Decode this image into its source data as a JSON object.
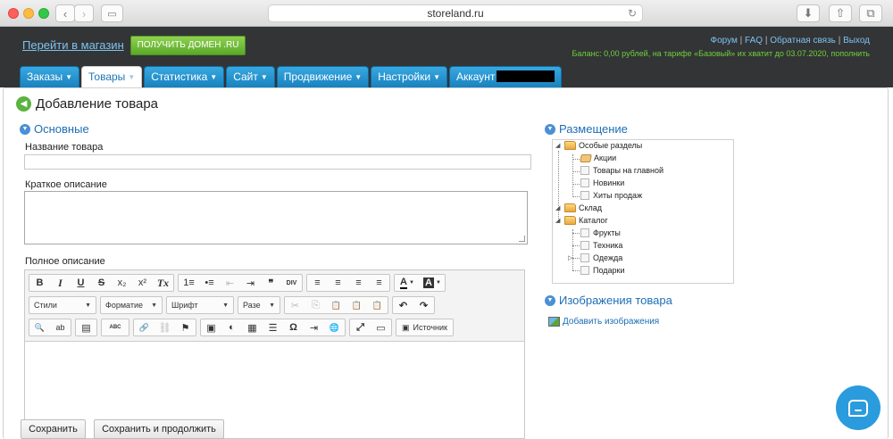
{
  "browser": {
    "url": "storeland.ru"
  },
  "header": {
    "shop_link": "Перейти в магазин",
    "domain_button": "ПОЛУЧИТЬ ДОМЕН .RU",
    "links": [
      "Форум",
      "FAQ",
      "Обратная связь",
      "Выход"
    ],
    "separator": "|",
    "balance_text": "Баланс: 0,00 рублей, на тарифе «Базовый» их хватит до 03.07.2020, пополнить"
  },
  "tabs": [
    {
      "label": "Заказы"
    },
    {
      "label": "Товары",
      "active": true
    },
    {
      "label": "Статистика"
    },
    {
      "label": "Сайт"
    },
    {
      "label": "Продвижение"
    },
    {
      "label": "Настройки"
    },
    {
      "label": "Аккаунт"
    }
  ],
  "page": {
    "title": "Добавление товара"
  },
  "main": {
    "section_title": "Основные",
    "name_label": "Название товара",
    "name_value": "",
    "short_label": "Краткое описание",
    "short_value": "",
    "full_label": "Полное описание"
  },
  "editor": {
    "format_buttons": [
      "B",
      "I",
      "U",
      "S",
      "x₂",
      "x²",
      "Tx"
    ],
    "list_buttons": [
      "1≡",
      "•≡",
      "⇤",
      "⇥",
      "❞",
      "DIV"
    ],
    "align_buttons": [
      "≡",
      "≡",
      "≡",
      "≡"
    ],
    "color_buttons": [
      "A",
      "A"
    ],
    "dropdowns": [
      "Стили",
      "Форматие",
      "Шрифт",
      "Разе"
    ],
    "clip_buttons": [
      "✂",
      "⎘",
      "📋",
      "📋",
      "📋"
    ],
    "undo_buttons": [
      "↶",
      "↷"
    ],
    "row3_a": [
      "🔍",
      "ab"
    ],
    "row3_b": [
      "▤"
    ],
    "row3_c": [
      "ABC"
    ],
    "row3_d": [
      "🔗",
      "⛓",
      "⚑"
    ],
    "row3_e": [
      "▣",
      "◐",
      "▦",
      "☰",
      "Ω",
      "⇥",
      "🌐"
    ],
    "row3_f": [
      "⤢",
      "▭"
    ],
    "source_button": "Источник"
  },
  "buttons": {
    "save": "Сохранить",
    "save_continue": "Сохранить и продолжить"
  },
  "placement": {
    "title": "Размещение",
    "tree": [
      {
        "label": "Особые разделы",
        "type": "folder"
      },
      {
        "label": "Акции",
        "type": "tag"
      },
      {
        "label": "Товары на главной",
        "type": "check"
      },
      {
        "label": "Новинки",
        "type": "check"
      },
      {
        "label": "Хиты продаж",
        "type": "check"
      },
      {
        "label": "Склад",
        "type": "folder"
      },
      {
        "label": "Каталог",
        "type": "folder"
      },
      {
        "label": "Фрукты",
        "type": "check"
      },
      {
        "label": "Техника",
        "type": "check"
      },
      {
        "label": "Одежда",
        "type": "check"
      },
      {
        "label": "Подарки",
        "type": "check"
      }
    ]
  },
  "images": {
    "title": "Изображения товара",
    "add_link": "Добавить изображения"
  },
  "colors": {
    "topbar": "#333436",
    "tab_blue": "#1882bf",
    "accent_green": "#5aa92a",
    "link_blue": "#1d6eb5",
    "chat": "#2a9bdd"
  }
}
